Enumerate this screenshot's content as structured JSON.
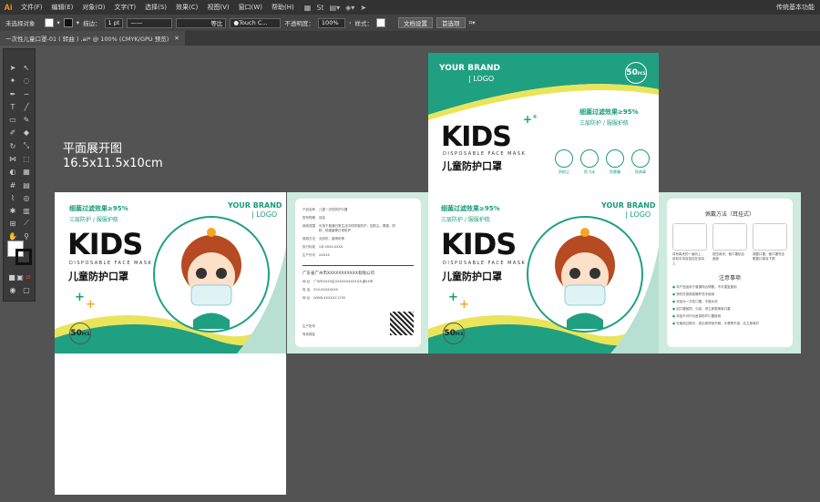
{
  "app": {
    "logo": "Ai",
    "workspace": "传统基本功能"
  },
  "menu": [
    "文件(F)",
    "编辑(E)",
    "对象(O)",
    "文字(T)",
    "选择(S)",
    "效果(C)",
    "视图(V)",
    "窗口(W)",
    "帮助(H)"
  ],
  "controlbar": {
    "selection": "未选择对象",
    "stroke_label": "描边：",
    "stroke_value": "1 pt",
    "profile": "等比",
    "brush": "Touch C...",
    "opacity_label": "不透明度：",
    "opacity_value": "100%",
    "style_label": "样式：",
    "doc_setup": "文档设置",
    "prefs": "首选项"
  },
  "document_tab": "一次性儿童口罩-01 ( 转曲 ) .ai* @ 100% (CMYK/GPU 预览)",
  "canvas": {
    "title": "平面展开图",
    "dimensions": "16.5x11.5x10cm"
  },
  "package": {
    "brand": "YOUR BRAND",
    "brand_sub": "LOGO",
    "count": "50",
    "count_unit": "PCS",
    "kids": "KIDS",
    "sub_en": "DISPOSABLE FACE MASK",
    "sub_cn": "儿童防护口罩",
    "filter": "细菌过滤效果≥95%",
    "tagline": "三层防护 / 服服护航",
    "features": [
      "防粉尘",
      "防飞沫",
      "防雾霾",
      "防病毒"
    ]
  },
  "info_panel": {
    "rows": [
      {
        "k": "产品名称",
        "v": "儿童一次性防护口罩"
      },
      {
        "k": "型号规格",
        "v": "耳挂"
      },
      {
        "k": "使用范围",
        "v": "可用于普通日常生活中的呼吸防护，如防尘、雾霾、防粉、防细菌等日常防护"
      },
      {
        "k": "使用方法",
        "v": "无纺布、熔喷布等"
      },
      {
        "k": "执行标准",
        "v": "GB XXXX-XXXX"
      },
      {
        "k": "生产许可",
        "v": "XXXXX"
      }
    ],
    "company": "广东省广州市XXXXXXXXXXX有限公司",
    "contact": [
      {
        "k": "地  址",
        "v": "广州市XXXX区XXXXXXXXXXX大道XX号"
      },
      {
        "k": "电  话",
        "v": "020-XXXXXXXX"
      },
      {
        "k": "网  址",
        "v": "WWW.XXXXXX.COM"
      }
    ],
    "prod_date": "生产批号",
    "valid": "有效期至"
  },
  "instruction_panel": {
    "title": "佩戴方法（耳挂式）",
    "steps": [
      "将有鼻夹的一面向上，用双手将耳挂挂在双耳上",
      "按压鼻夹，使口罩贴合面部",
      "调整口罩，使口罩完全覆盖口鼻及下颌"
    ],
    "notes_title": "注意事项",
    "notes": [
      "本产品适用于普通场合佩戴，不可重复使用",
      "请勿在易燃易爆环境中使用",
      "本品为一次性口罩，不能水洗",
      "如口罩破损、污染，请立即更换新口罩",
      "本品不可作为医用防护口罩使用",
      "在使用过程中，如出现呼吸不畅、头晕等不适，应立即离开"
    ]
  }
}
